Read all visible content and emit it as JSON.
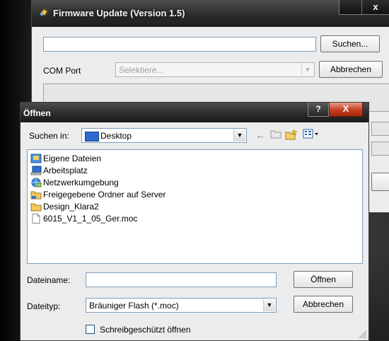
{
  "background_window": {
    "title": "Firmware Update (Version 1.5)",
    "close_glyph": "x",
    "path_value": "",
    "search_button": "Suchen...",
    "com_port_label": "COM Port",
    "com_port_placeholder": "Selektiere...",
    "cancel_button": "Abbrechen"
  },
  "open_dialog": {
    "title": "Öffnen",
    "help_glyph": "?",
    "close_glyph": "X",
    "look_in_label": "Suchen in:",
    "look_in_value": "Desktop",
    "files": [
      {
        "name": "Eigene Dateien",
        "icon": "my-documents-icon"
      },
      {
        "name": "Arbeitsplatz",
        "icon": "my-computer-icon"
      },
      {
        "name": "Netzwerkumgebung",
        "icon": "network-icon"
      },
      {
        "name": "Freigegebene Ordner auf Server",
        "icon": "shared-folder-icon"
      },
      {
        "name": "Design_Klara2",
        "icon": "folder-icon"
      },
      {
        "name": "6015_V1_1_05_Ger.moc",
        "icon": "file-icon"
      }
    ],
    "filename_label": "Dateiname:",
    "filename_value": "",
    "filetype_label": "Dateityp:",
    "filetype_value": "Bräuniger Flash (*.moc)",
    "open_button": "Öffnen",
    "cancel_button": "Abbrechen",
    "readonly_label": "Schreibgeschützt öffnen",
    "readonly_checked": false
  }
}
